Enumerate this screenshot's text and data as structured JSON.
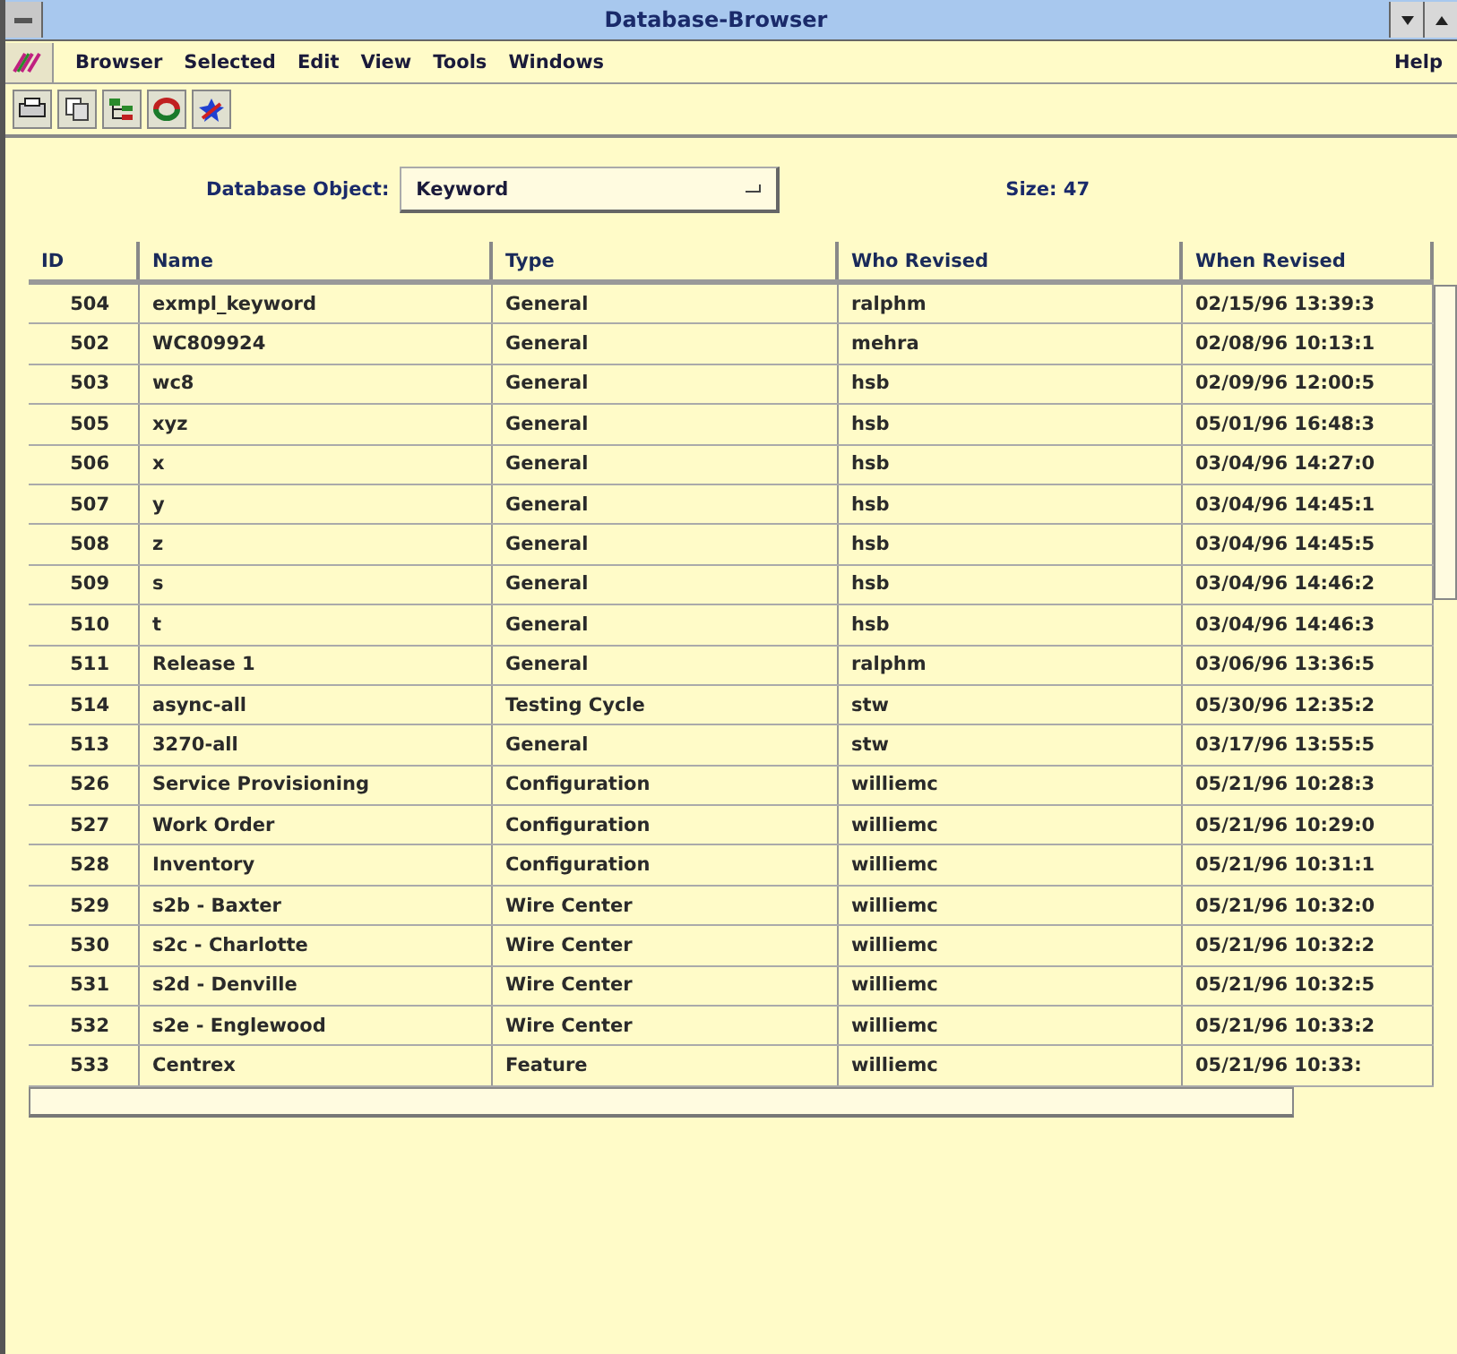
{
  "window": {
    "title": "Database-Browser"
  },
  "menu": [
    "Browser",
    "Selected",
    "Edit",
    "View",
    "Tools",
    "Windows"
  ],
  "help": "Help",
  "form": {
    "object_label": "Database Object:",
    "object_value": "Keyword",
    "size": "Size: 47"
  },
  "table": {
    "columns": [
      "ID",
      "Name",
      "Type",
      "Who Revised",
      "When Revised"
    ],
    "rows": [
      [
        "504",
        "exmpl_keyword",
        "General",
        "ralphm",
        "02/15/96 13:39:3"
      ],
      [
        "502",
        "WC809924",
        "General",
        "mehra",
        "02/08/96 10:13:1"
      ],
      [
        "503",
        "wc8",
        "General",
        "hsb",
        "02/09/96 12:00:5"
      ],
      [
        "505",
        "xyz",
        "General",
        "hsb",
        "05/01/96 16:48:3"
      ],
      [
        "506",
        "x",
        "General",
        "hsb",
        "03/04/96 14:27:0"
      ],
      [
        "507",
        "y",
        "General",
        "hsb",
        "03/04/96 14:45:1"
      ],
      [
        "508",
        "z",
        "General",
        "hsb",
        "03/04/96 14:45:5"
      ],
      [
        "509",
        "s",
        "General",
        "hsb",
        "03/04/96 14:46:2"
      ],
      [
        "510",
        "t",
        "General",
        "hsb",
        "03/04/96 14:46:3"
      ],
      [
        "511",
        "Release 1",
        "General",
        "ralphm",
        "03/06/96 13:36:5"
      ],
      [
        "514",
        "async-all",
        "Testing Cycle",
        "stw",
        "05/30/96 12:35:2"
      ],
      [
        "513",
        "3270-all",
        "General",
        "stw",
        "03/17/96 13:55:5"
      ],
      [
        "526",
        "Service Provisioning",
        "Configuration",
        "williemc",
        "05/21/96 10:28:3"
      ],
      [
        "527",
        "Work Order",
        "Configuration",
        "williemc",
        "05/21/96 10:29:0"
      ],
      [
        "528",
        "Inventory",
        "Configuration",
        "williemc",
        "05/21/96 10:31:1"
      ],
      [
        "529",
        "s2b - Baxter",
        "Wire Center",
        "williemc",
        "05/21/96 10:32:0"
      ],
      [
        "530",
        "s2c  - Charlotte",
        "Wire Center",
        "williemc",
        "05/21/96 10:32:2"
      ],
      [
        "531",
        "s2d - Denville",
        "Wire Center",
        "williemc",
        "05/21/96 10:32:5"
      ],
      [
        "532",
        "s2e - Englewood",
        "Wire Center",
        "williemc",
        "05/21/96 10:33:2"
      ],
      [
        "533",
        "Centrex",
        "Feature",
        "williemc",
        "05/21/96 10:33:"
      ]
    ]
  }
}
